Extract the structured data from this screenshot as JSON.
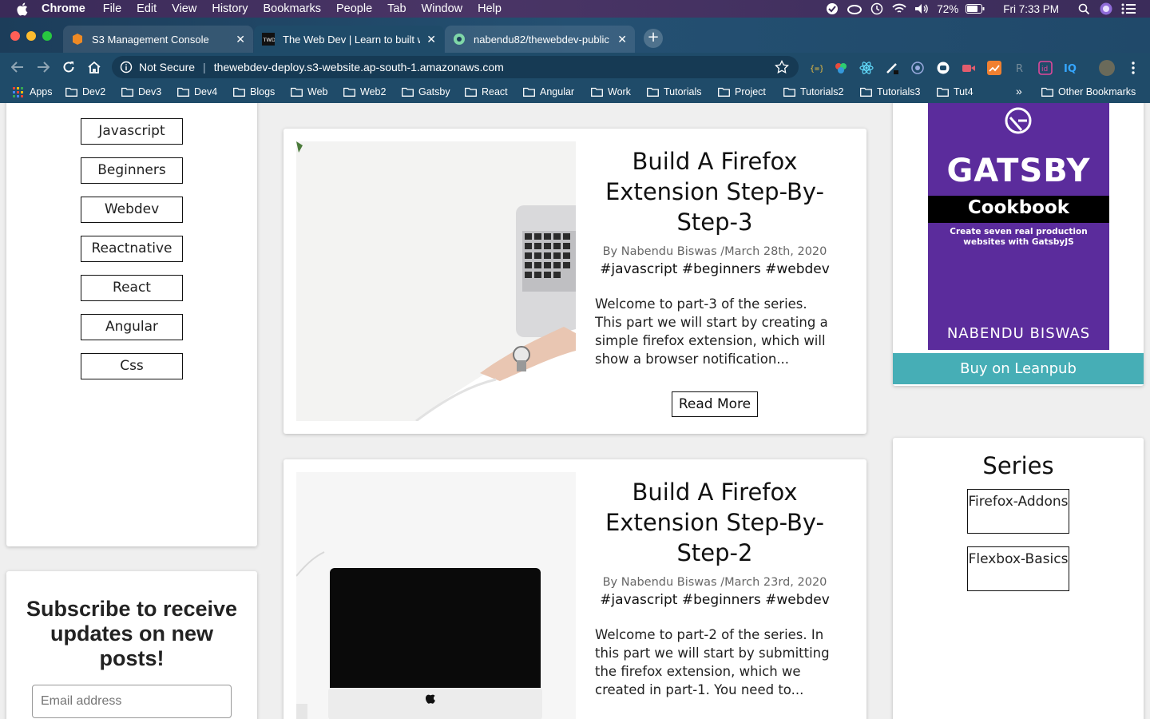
{
  "menubar": {
    "items": [
      "Chrome",
      "File",
      "Edit",
      "View",
      "History",
      "Bookmarks",
      "People",
      "Tab",
      "Window",
      "Help"
    ],
    "battery": "72%",
    "clock": "Fri 7:33 PM"
  },
  "tabs": [
    {
      "title": "S3 Management Console",
      "active": false
    },
    {
      "title": "The Web Dev | Learn to built w",
      "active": true
    },
    {
      "title": "nabendu82/thewebdev-public",
      "active": false
    }
  ],
  "omnibox": {
    "security_label": "Not Secure",
    "url": "thewebdev-deploy.s3-website.ap-south-1.amazonaws.com"
  },
  "bookmarks": {
    "apps_label": "Apps",
    "folders": [
      "Dev2",
      "Dev3",
      "Dev4",
      "Blogs",
      "Web",
      "Web2",
      "Gatsby",
      "React",
      "Angular",
      "Work",
      "Tutorials",
      "Project",
      "Tutorials2",
      "Tutorials3",
      "Tut4"
    ],
    "overflow": "»",
    "other": "Other Bookmarks"
  },
  "sidebar": {
    "tags": [
      "Javascript",
      "Beginners",
      "Webdev",
      "Reactnative",
      "React",
      "Angular",
      "Css"
    ]
  },
  "subscribe": {
    "heading": "Subscribe to receive updates on new posts!",
    "email_placeholder": "Email address"
  },
  "posts": [
    {
      "title": "Build A Firefox Extension Step-By-Step-3",
      "meta": "By Nabendu Biswas /March 28th, 2020",
      "tags": "#javascript #beginners #webdev",
      "excerpt": "Welcome to part-3 of the series. This part we will start by creating a simple firefox extension, which will show a browser notification...",
      "read_more": "Read More"
    },
    {
      "title": "Build A Firefox Extension Step-By-Step-2",
      "meta": "By Nabendu Biswas /March 23rd, 2020",
      "tags": "#javascript #beginners #webdev",
      "excerpt": "Welcome to part-2 of the series. In this part we will start by submitting the firefox extension, which we created in part-1. You need to..."
    }
  ],
  "book": {
    "title": "GATSBY",
    "subtitle": "Cookbook",
    "tagline": "Create seven real production websites with GatsbyJS",
    "author": "NABENDU BISWAS",
    "buy_label": "Buy on Leanpub",
    "cover_color": "#5b2c9c"
  },
  "series": {
    "heading": "Series",
    "items": [
      "Firefox-Addons",
      "Flexbox-Basics"
    ]
  },
  "colors": {
    "accent_teal": "#46aeb6",
    "chrome_frame": "#1f4b69"
  }
}
